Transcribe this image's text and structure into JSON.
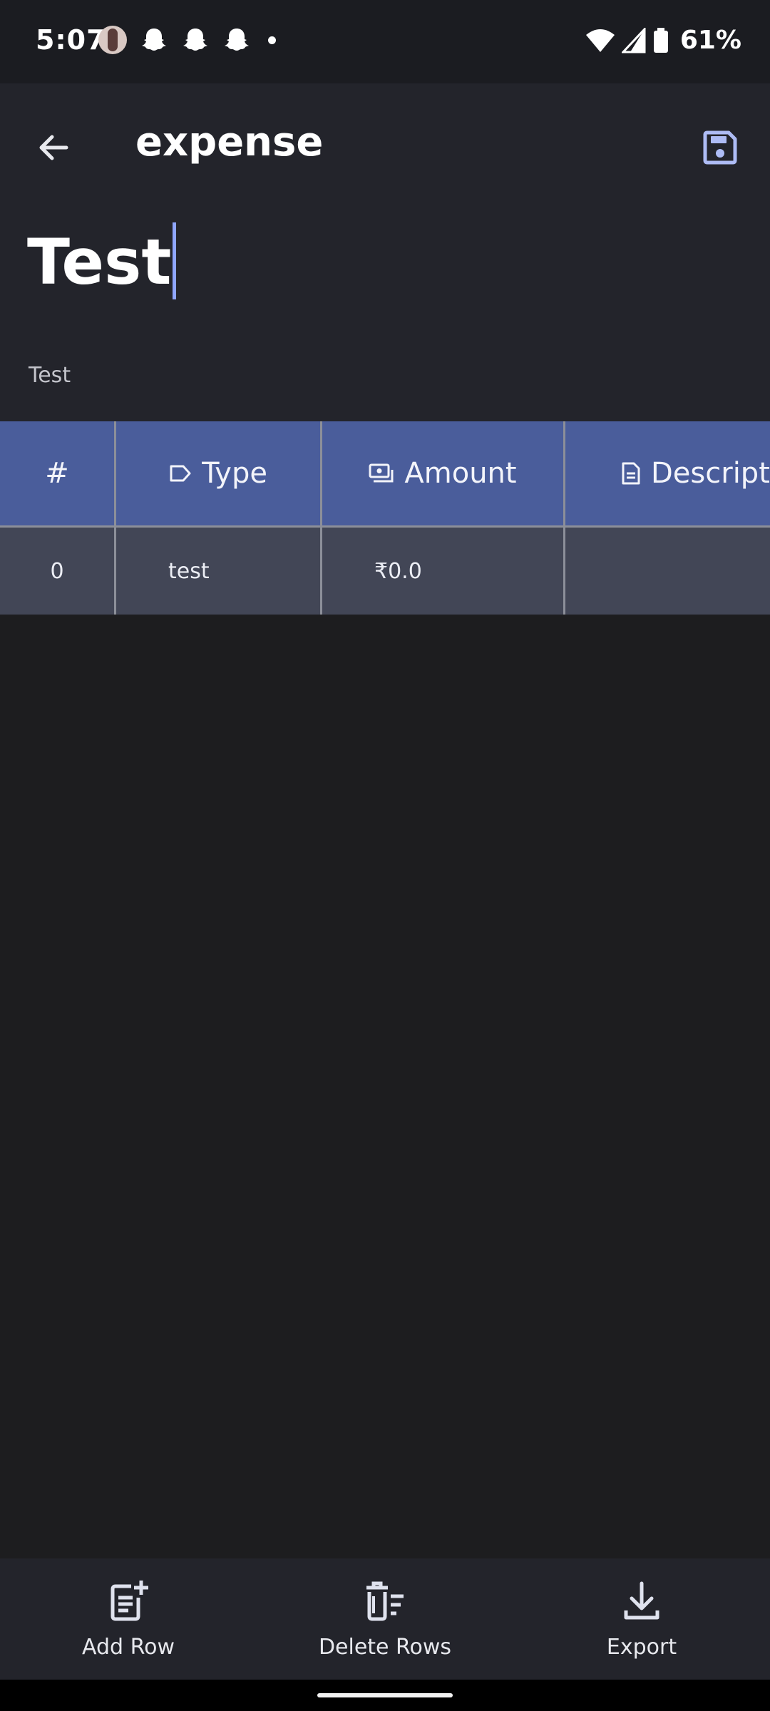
{
  "status_bar": {
    "time": "5:07",
    "battery": "61%"
  },
  "app_bar": {
    "title": "expense",
    "back_icon": "arrow-left-icon",
    "save_icon": "floppy-disk-icon"
  },
  "sheet": {
    "title": "Test",
    "subtitle": "Test"
  },
  "table": {
    "headers": [
      {
        "label": "#",
        "icon": ""
      },
      {
        "label": "Type",
        "icon": "tag-icon"
      },
      {
        "label": "Amount",
        "icon": "cash-icon"
      },
      {
        "label": "Descripti",
        "icon": "document-icon"
      }
    ],
    "rows": [
      {
        "num": "0",
        "type": "test",
        "amount": "₹0.0",
        "description": ""
      }
    ]
  },
  "bottom_nav": {
    "add_row": "Add Row",
    "delete_rows": "Delete Rows",
    "export": "Export"
  },
  "colors": {
    "header_bg": "#4a5d9b",
    "row_bg": "#424656",
    "accent": "#aebcf5"
  }
}
